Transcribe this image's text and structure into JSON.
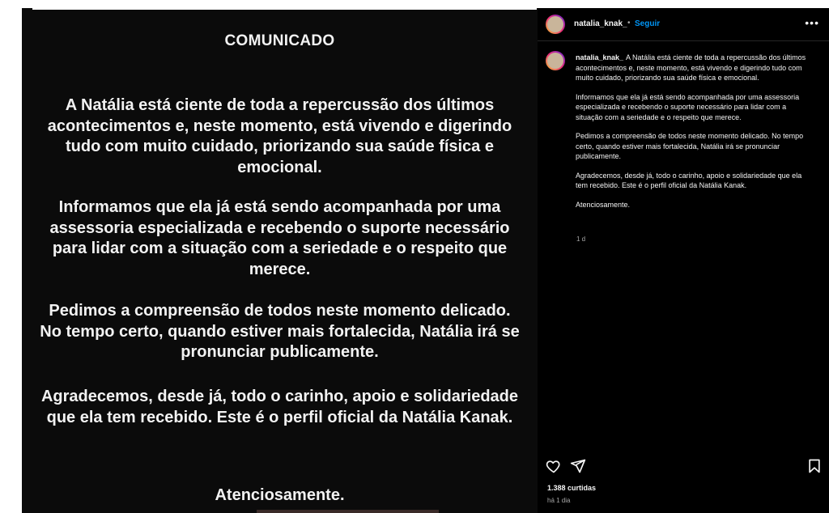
{
  "image": {
    "title": "COMUNICADO",
    "paragraphs": [
      "A Natália está ciente de toda a repercussão dos últimos acontecimentos e, neste momento, está vivendo e digerindo tudo com muito cuidado, priorizando sua saúde física e emocional.",
      "Informamos que ela já está sendo acompanhada por uma assessoria especializada e recebendo o suporte necessário para lidar com a situação com a seriedade e o respeito que merece.",
      "Pedimos a compreensão de todos neste momento delicado. No tempo certo, quando estiver mais fortalecida, Natália irá se pronunciar publicamente.",
      "Agradecemos, desde já, todo o carinho, apoio e solidariedade que ela tem recebido. Este é o perfil oficial da Natália Kanak.",
      "Atenciosamente."
    ]
  },
  "header": {
    "username": "natalia_knak_",
    "separator": "•",
    "follow_label": "Seguir",
    "more_icon": "more-horizontal-icon"
  },
  "caption": {
    "username": "natalia_knak_",
    "paragraphs": [
      "A Natália está ciente de toda a repercussão dos últimos acontecimentos e, neste momento, está vivendo e digerindo tudo com muito cuidado, priorizando sua saúde física e emocional.",
      "Informamos que ela já está sendo acompanhada por uma assessoria especializada e recebendo o suporte necessário para lidar com a situação com a seriedade e o respeito que merece.",
      "Pedimos a compreensão de todos neste momento delicado. No tempo certo, quando estiver mais fortalecida, Natália irá se pronunciar publicamente.",
      "Agradecemos, desde já, todo o carinho, apoio e solidariedade que ela tem recebido. Este é o perfil oficial da Natália Kanak.",
      "Atenciosamente."
    ],
    "age": "1 d"
  },
  "actions": {
    "icons": [
      "heart-icon",
      "send-icon",
      "bookmark-icon"
    ],
    "likes": "1.388 curtidas",
    "time": "há 1 dia"
  },
  "colors": {
    "accent": "#0095f6",
    "panel_bg": "#000000",
    "image_bg": "#0b0b0b"
  }
}
